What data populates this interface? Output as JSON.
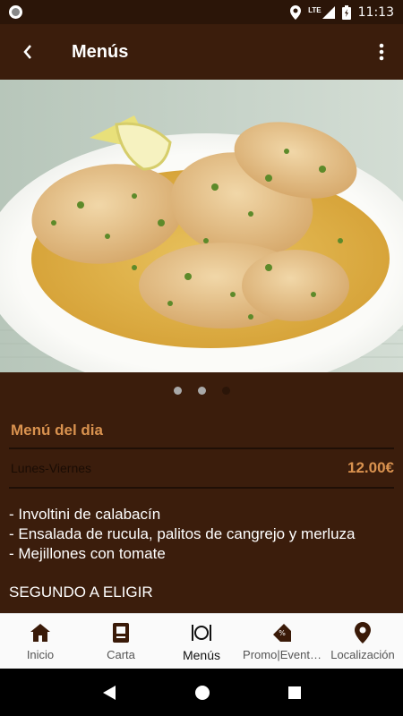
{
  "status_bar": {
    "network": "LTE",
    "time": "11:13"
  },
  "app_bar": {
    "title": "Menús"
  },
  "carousel": {
    "image": "plate-of-scallopini-with-lemon",
    "dots_count": 3,
    "active_dot": 3
  },
  "menu": {
    "title": "Menú del dia",
    "days": "Lunes-Viernes",
    "price": "12.00€",
    "items": [
      "- Involtini de calabacín",
      "- Ensalada de rucula, palitos de cangrejo y merluza",
      "- Mejillones con tomate"
    ],
    "section_second": "SEGUNDO A ELIGIR"
  },
  "bottom_nav": {
    "items": [
      {
        "label": "Inicio",
        "icon": "home-icon"
      },
      {
        "label": "Carta",
        "icon": "menu-card-icon"
      },
      {
        "label": "Menús",
        "icon": "plate-cutlery-icon"
      },
      {
        "label": "Promo|Event…",
        "icon": "promo-tag-icon"
      },
      {
        "label": "Localización",
        "icon": "location-pin-icon"
      }
    ],
    "active": "Menús"
  },
  "colors": {
    "background": "#3b1d0c",
    "accent": "#d9924f",
    "status_bar": "#2b1508"
  }
}
